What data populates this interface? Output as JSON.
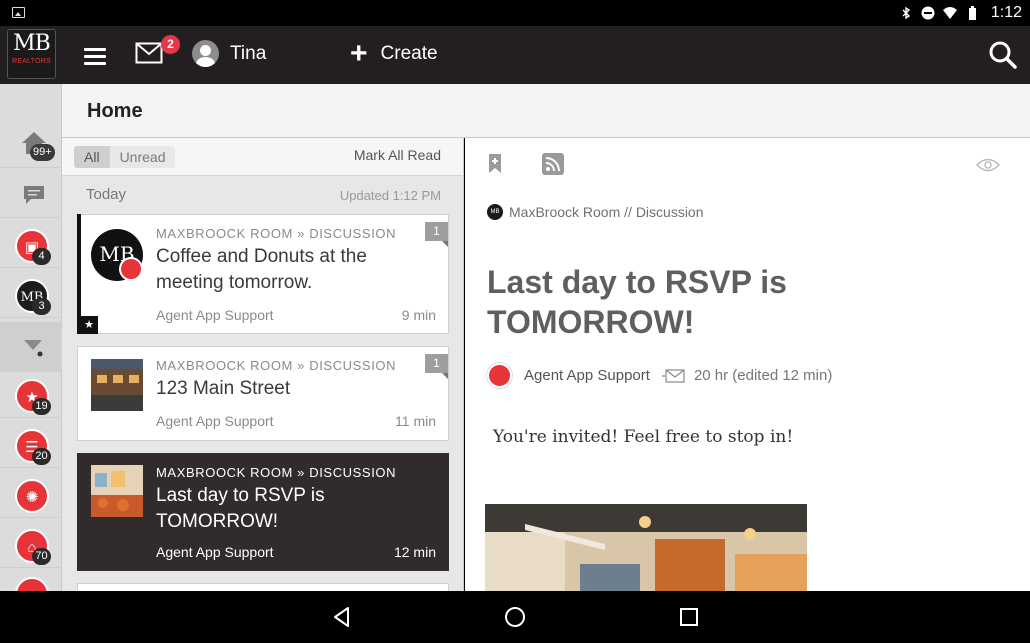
{
  "status_bar": {
    "time": "1:12"
  },
  "app_bar": {
    "logo_text": "MB",
    "logo_subtext": "REALTORS",
    "mail_badge": "2",
    "user_name": "Tina",
    "create_label": "Create"
  },
  "rail": {
    "items": [
      {
        "icon": "home-icon",
        "count": "99+"
      },
      {
        "icon": "chat-icon",
        "count": ""
      },
      {
        "icon": "briefcase-icon",
        "count": "4"
      },
      {
        "icon": "mb-logo-icon",
        "count": "3"
      },
      {
        "icon": "filter-icon",
        "count": ""
      },
      {
        "icon": "star-people-icon",
        "count": "19"
      },
      {
        "icon": "list-icon",
        "count": "20"
      },
      {
        "icon": "lightbulb-icon",
        "count": ""
      },
      {
        "icon": "store-icon",
        "count": "70"
      }
    ]
  },
  "page": {
    "title": "Home"
  },
  "list": {
    "filter_all": "All",
    "filter_unread": "Unread",
    "mark_all_read": "Mark All Read",
    "day_label": "Today",
    "updated": "Updated 1:12 PM",
    "cards": [
      {
        "crumb": "MAXBROOCK ROOM » DISCUSSION",
        "title": "Coffee and Donuts at the meeting tomorrow.",
        "author": "Agent App Support",
        "time": "9 min",
        "count": "1"
      },
      {
        "crumb": "MAXBROOCK ROOM » DISCUSSION",
        "title": "123 Main Street",
        "author": "Agent App Support",
        "time": "11 min",
        "count": "1"
      },
      {
        "crumb": "MAXBROOCK ROOM » DISCUSSION",
        "title": "Last day to RSVP is TOMORROW!",
        "author": "Agent App Support",
        "time": "12 min"
      }
    ]
  },
  "detail": {
    "room": "MaxBroock Room // Discussion",
    "title": "Last day to RSVP is TOMORROW!",
    "author": "Agent App Support",
    "ago": "20 hr (edited 12 min)",
    "body": "You're invited! Feel free to stop in!"
  },
  "colors": {
    "accent": "#e63439",
    "appbar": "#231f20",
    "active_card": "#312b2b"
  }
}
